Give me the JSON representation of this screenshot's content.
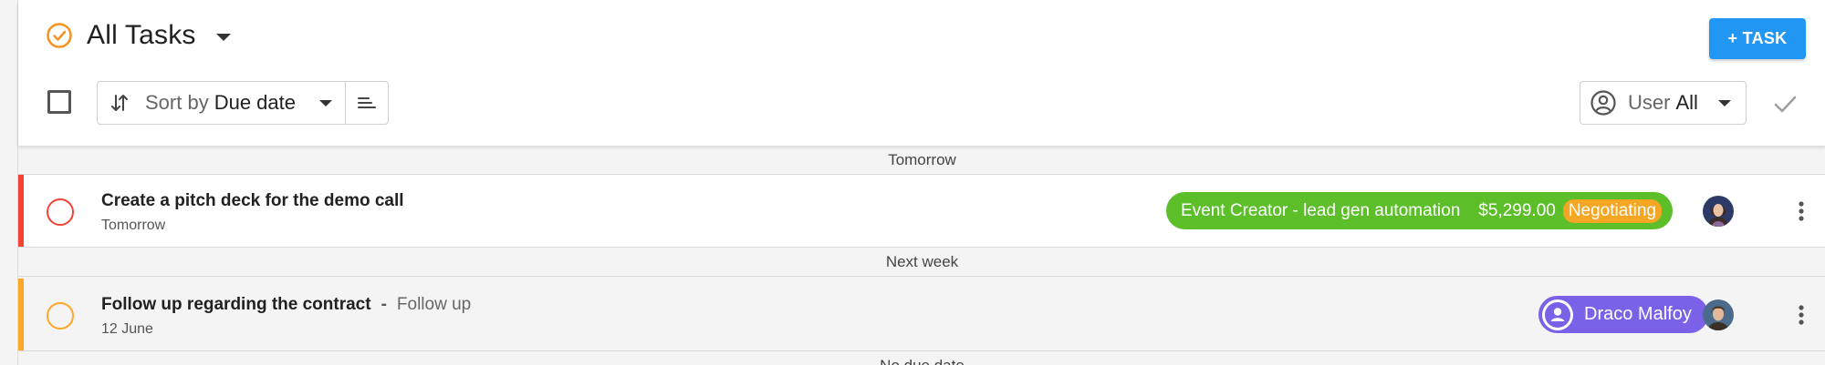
{
  "header": {
    "title": "All Tasks",
    "add_task_label": "+ TASK",
    "sort_prefix": "Sort by",
    "sort_value": "Due date",
    "user_prefix": "User",
    "user_value": "All"
  },
  "icons": {
    "title": "check-circle-icon",
    "sort": "sort-arrows-icon",
    "sort_order": "sort-lines-icon",
    "user": "user-circle-icon",
    "apply": "check-icon",
    "more": "more-vertical-icon"
  },
  "colors": {
    "accent_orange": "#f59322",
    "primary_blue": "#2196f3",
    "priority_high": "#f44336",
    "priority_medium": "#ffa726",
    "deal_green": "#5cbf2a",
    "stage_orange": "#f5a623",
    "contact_purple": "#7b61e8"
  },
  "groups": [
    {
      "label": "Tomorrow",
      "tasks": [
        {
          "title": "Create a pitch deck for the demo call",
          "date": "Tomorrow",
          "deal": {
            "name": "Event Creator - lead gen automation",
            "amount": "$5,299.00",
            "stage": "Negotiating"
          }
        }
      ]
    },
    {
      "label": "Next week",
      "tasks": [
        {
          "title": "Follow up regarding the contract",
          "separator": "-",
          "type": "Follow up",
          "date": "12 June",
          "contact": {
            "name": "Draco Malfoy"
          }
        }
      ]
    },
    {
      "label": "No due date"
    }
  ]
}
